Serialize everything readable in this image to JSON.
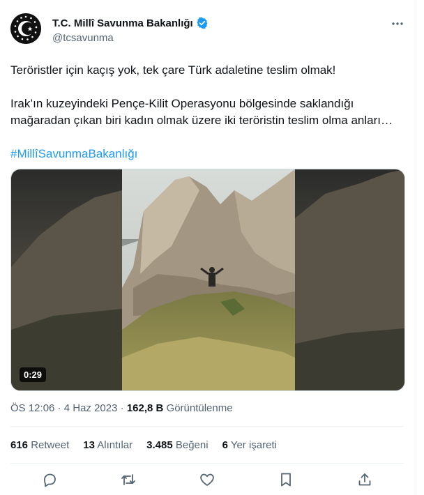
{
  "account": {
    "display_name": "T.C. Millî Savunma Bakanlığı",
    "handle": "@tcsavunma",
    "avatar_icon": "turkish-crest-icon",
    "verified_icon": "verified-badge-icon"
  },
  "tweet": {
    "line1": "Teröristler için kaçış yok, tek çare Türk adaletine teslim olmak!",
    "line2": "Irak’ın kuzeyindeki Pençe-Kilit Operasyonu bölgesinde saklandığı mağaradan çıkan biri kadın olmak üzere iki teröristin teslim olma anları…",
    "hashtag": "#MillîSavunmaBakanlığı"
  },
  "media": {
    "duration": "0:29"
  },
  "meta": {
    "time": "ÖS 12:06",
    "sep1": " · ",
    "date": "4 Haz 2023",
    "sep2": " · ",
    "views_count": "162,8 B",
    "views_label": " Görüntülenme"
  },
  "stats": {
    "retweets_count": "616",
    "retweets_label": "Retweet",
    "quotes_count": "13",
    "quotes_label": "Alıntılar",
    "likes_count": "3.485",
    "likes_label": "Beğeni",
    "bookmarks_count": "6",
    "bookmarks_label": "Yer işareti"
  },
  "colors": {
    "text": "#0f1419",
    "secondary": "#536471",
    "link": "#1d9bf0",
    "verified": "#1d9bf0"
  },
  "icons": [
    "reply-icon",
    "retweet-icon",
    "like-icon",
    "bookmark-icon",
    "share-icon",
    "more-icon"
  ]
}
